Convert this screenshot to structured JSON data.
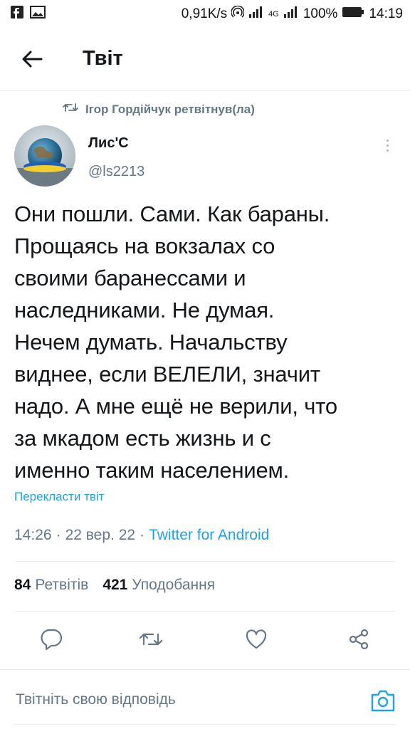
{
  "status_bar": {
    "speed": "0,91K/s",
    "network": "4G",
    "battery": "100%",
    "time": "14:19",
    "icons": [
      "facebook-icon",
      "gallery-icon",
      "hotspot-icon",
      "signal-icon",
      "battery-icon"
    ]
  },
  "header": {
    "title": "Твіт",
    "back_icon": "arrow-left-icon"
  },
  "retweet_context": {
    "text": "Ігор Гордійчук ретвітнув(ла)",
    "icon": "retweet-icon"
  },
  "author": {
    "name": "Лис'С",
    "handle": "@ls2213",
    "avatar": "avatar-globe"
  },
  "tweet": {
    "text": "Они пошли. Сами. Как бараны.\nПрощаясь на вокзалах со\nсвоими баранессами и\nнаследниками. Не думая.\nНечем думать. Начальству\nвиднее, если ВЕЛЕЛИ, значит\nнадо. А мне ещё не верили, что\nза мкадом есть жизнь и с\nименно таким населением.",
    "translate_label": "Перекласти твіт",
    "time": "14:26",
    "date": "22 вер. 22",
    "source": "Twitter for Android",
    "separator": "·"
  },
  "stats": {
    "retweets_count": "84",
    "retweets_label": "Ретвітів",
    "likes_count": "421",
    "likes_label": "Уподобання"
  },
  "actions": [
    "reply-icon",
    "retweet-icon",
    "like-icon",
    "share-icon"
  ],
  "reply": {
    "placeholder": "Твітніть свою відповідь",
    "camera_icon": "camera-icon"
  },
  "colors": {
    "accent": "#1da1f2",
    "secondary_text": "#657786",
    "primary_text": "#14171a",
    "border": "#e6ecf0"
  }
}
